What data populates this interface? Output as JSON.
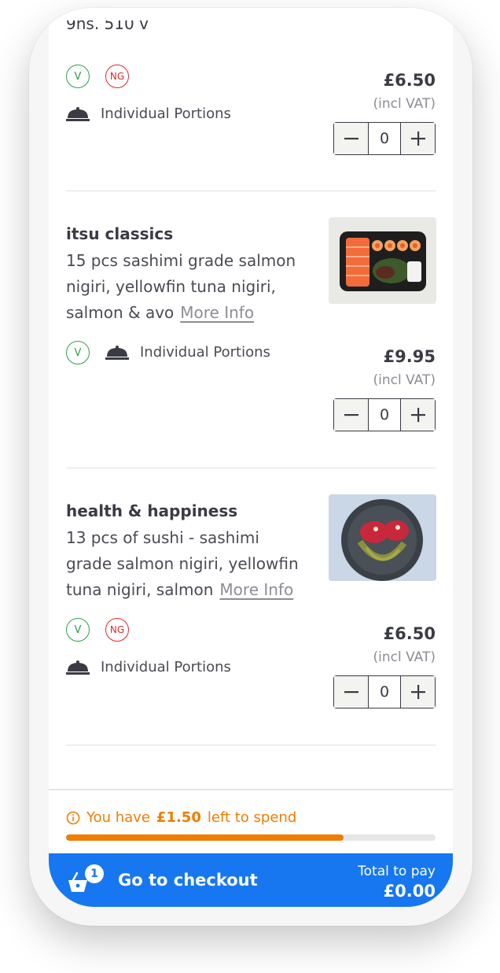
{
  "top_item": {
    "clipped_text": "9ns. 510 v",
    "badges": [
      "V",
      "NG"
    ],
    "portions_label": "Individual Portions",
    "price": "£6.50",
    "vat": "(incl VAT)",
    "quantity": "0"
  },
  "items": [
    {
      "title": "itsu classics",
      "description": "15 pcs sashimi grade salmon nigiri, yellowfin tuna nigiri, salmon & avo",
      "more_info": "More Info",
      "badges": [
        "V"
      ],
      "portions_label": "Individual Portions",
      "price": "£9.95",
      "vat": "(incl VAT)",
      "quantity": "0"
    },
    {
      "title": "health & happiness",
      "description": "13 pcs of sushi - sashimi grade salmon nigiri, yellowfin tuna nigiri, salmon",
      "more_info": "More Info",
      "badges": [
        "V",
        "NG"
      ],
      "portions_label": "Individual Portions",
      "price": "£6.50",
      "vat": "(incl VAT)",
      "quantity": "0"
    }
  ],
  "spend": {
    "prefix": "You have",
    "amount": "£1.50",
    "suffix": "left to spend",
    "progress_fraction": 0.75
  },
  "checkout": {
    "basket_count": "1",
    "label": "Go to checkout",
    "total_label": "Total to pay",
    "total_value": "£0.00"
  },
  "colors": {
    "accent_blue": "#1677f0",
    "spend_orange": "#f07d00",
    "veg_green": "#2aa24a",
    "ng_red": "#e3262a"
  },
  "icons": [
    "cloche-icon",
    "minus-icon",
    "plus-icon",
    "info-icon",
    "basket-icon"
  ]
}
